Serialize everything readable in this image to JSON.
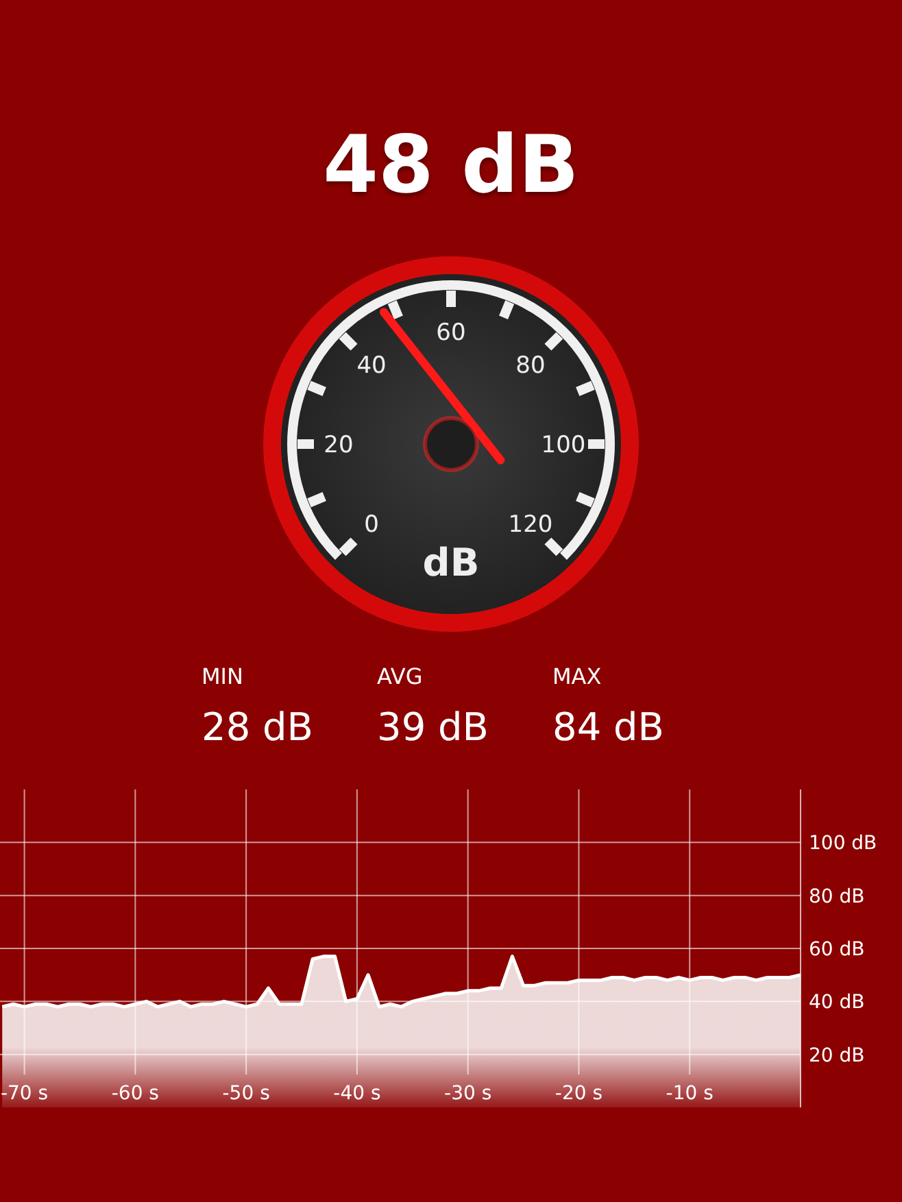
{
  "reading": "48 dB",
  "gauge": {
    "unit": "dB",
    "scale_labels": [
      "0",
      "20",
      "40",
      "60",
      "80",
      "100",
      "120"
    ]
  },
  "stats": [
    {
      "label": "MIN",
      "value": "28 dB"
    },
    {
      "label": "AVG",
      "value": "39 dB"
    },
    {
      "label": "MAX",
      "value": "84 dB"
    }
  ],
  "history": {
    "chart_data": {
      "type": "area",
      "grid": true,
      "xlim": [
        -72.2,
        0
      ],
      "ylim": [
        0,
        120
      ],
      "xticks": [
        {
          "value": -70,
          "label": "-70 s"
        },
        {
          "value": -60,
          "label": "-60 s"
        },
        {
          "value": -50,
          "label": "-50 s"
        },
        {
          "value": -40,
          "label": "-40 s"
        },
        {
          "value": -30,
          "label": "-30 s"
        },
        {
          "value": -20,
          "label": "-20 s"
        },
        {
          "value": -10,
          "label": "-10 s"
        }
      ],
      "yticks": [
        {
          "value": 20,
          "label": "20 dB"
        },
        {
          "value": 40,
          "label": "40 dB"
        },
        {
          "value": 60,
          "label": "60 dB"
        },
        {
          "value": 80,
          "label": "80 dB"
        },
        {
          "value": 100,
          "label": "100 dB"
        }
      ],
      "x": [
        -72,
        -71,
        -70,
        -69,
        -68,
        -67,
        -66,
        -65,
        -64,
        -63,
        -62,
        -61,
        -60,
        -59,
        -58,
        -57,
        -56,
        -55,
        -54,
        -53,
        -52,
        -51,
        -50,
        -49,
        -48,
        -47,
        -46,
        -45,
        -44,
        -43,
        -42,
        -41,
        -40,
        -39,
        -38,
        -37,
        -36,
        -35,
        -34,
        -33,
        -32,
        -31,
        -30,
        -29,
        -28,
        -27,
        -26,
        -25,
        -24,
        -23,
        -22,
        -21,
        -20,
        -19,
        -18,
        -17,
        -16,
        -15,
        -14,
        -13,
        -12,
        -11,
        -10,
        -9,
        -8,
        -7,
        -6,
        -5,
        -4,
        -3,
        -2,
        -1,
        0
      ],
      "series": [
        {
          "color": "#ffffff",
          "values": [
            38,
            39,
            38,
            39,
            39,
            38,
            39,
            39,
            38,
            39,
            39,
            38,
            39,
            40,
            38,
            39,
            40,
            38,
            39,
            39,
            40,
            39,
            38,
            39,
            45,
            39,
            39,
            39,
            56,
            57,
            57,
            40,
            41,
            50,
            38,
            39,
            38,
            40,
            41,
            42,
            43,
            43,
            44,
            44,
            45,
            45,
            57,
            46,
            46,
            47,
            47,
            47,
            48,
            48,
            48,
            49,
            49,
            48,
            49,
            49,
            48,
            49,
            48,
            49,
            49,
            48,
            49,
            49,
            48,
            49,
            49,
            49,
            50
          ]
        }
      ]
    }
  }
}
